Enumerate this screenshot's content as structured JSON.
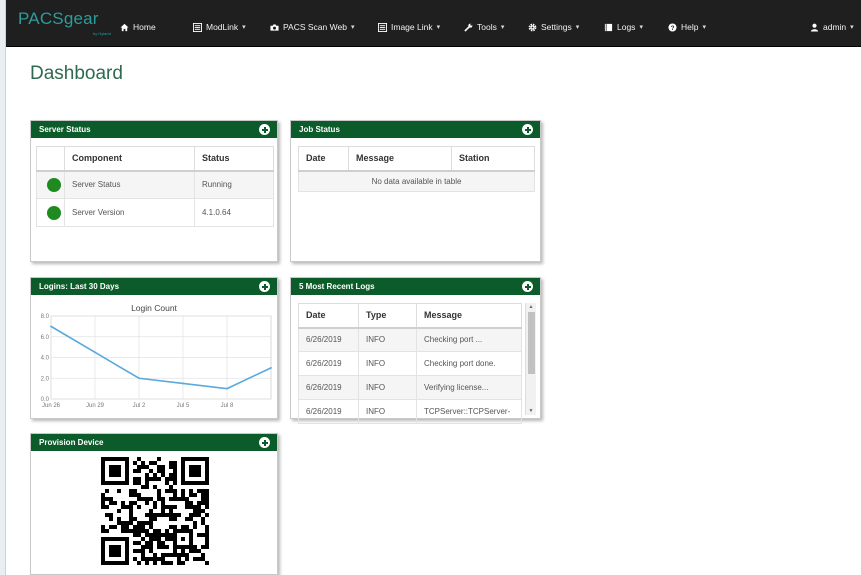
{
  "navbar": {
    "brand": "PACSgear",
    "brand_sub": "by Hyland",
    "items": [
      {
        "label": "Home",
        "icon": "home-icon"
      },
      {
        "label": "ModLink",
        "icon": "list-icon"
      },
      {
        "label": "PACS Scan Web",
        "icon": "camera-icon"
      },
      {
        "label": "Image Link",
        "icon": "list-icon"
      },
      {
        "label": "Tools",
        "icon": "wrench-icon"
      },
      {
        "label": "Settings",
        "icon": "gear-icon"
      },
      {
        "label": "Logs",
        "icon": "book-icon"
      },
      {
        "label": "Help",
        "icon": "question-icon"
      },
      {
        "label": "admin",
        "icon": "user-icon"
      }
    ]
  },
  "page": {
    "title": "Dashboard"
  },
  "server_status": {
    "title": "Server Status",
    "columns": [
      "",
      "Component",
      "Status"
    ],
    "rows": [
      {
        "component": "Server Status",
        "status": "Running"
      },
      {
        "component": "Server Version",
        "status": "4.1.0.64"
      }
    ]
  },
  "job_status": {
    "title": "Job Status",
    "columns": [
      "Date",
      "Message",
      "Station"
    ],
    "empty": "No data available in table"
  },
  "logins": {
    "title": "Logins: Last 30 Days"
  },
  "chart_data": {
    "type": "line",
    "title": "Login Count",
    "x": [
      "Jun 26",
      "Jun 29",
      "Jul 2",
      "Jul 5",
      "Jul 8",
      "Jul 9"
    ],
    "y": [
      7.0,
      4.5,
      2.0,
      1.5,
      1.0,
      3.0
    ],
    "ylim": [
      0,
      8
    ],
    "yticks": [
      "0.0",
      "2.0",
      "4.0",
      "6.0",
      "8.0"
    ],
    "xticks": [
      "Jun 26",
      "Jun 29",
      "Jul 2",
      "Jul 5",
      "Jul 8"
    ],
    "grid": true,
    "line_color": "#5aa9dd"
  },
  "recent_logs": {
    "title": "5 Most Recent Logs",
    "columns": [
      "Date",
      "Type",
      "Message"
    ],
    "rows": [
      {
        "date": "6/26/2019",
        "type": "INFO",
        "message": "Checking port ..."
      },
      {
        "date": "6/26/2019",
        "type": "INFO",
        "message": "Checking port done."
      },
      {
        "date": "6/26/2019",
        "type": "INFO",
        "message": "Verifying license..."
      },
      {
        "date": "6/26/2019",
        "type": "INFO",
        "message": "TCPServer::TCPServer-"
      }
    ]
  },
  "provision": {
    "title": "Provision Device"
  },
  "colors": {
    "panel_header": "#0c5c2b",
    "navbar": "#1f1f1f",
    "brand": "#2d9c9a",
    "status_ok": "#1f8a20"
  }
}
